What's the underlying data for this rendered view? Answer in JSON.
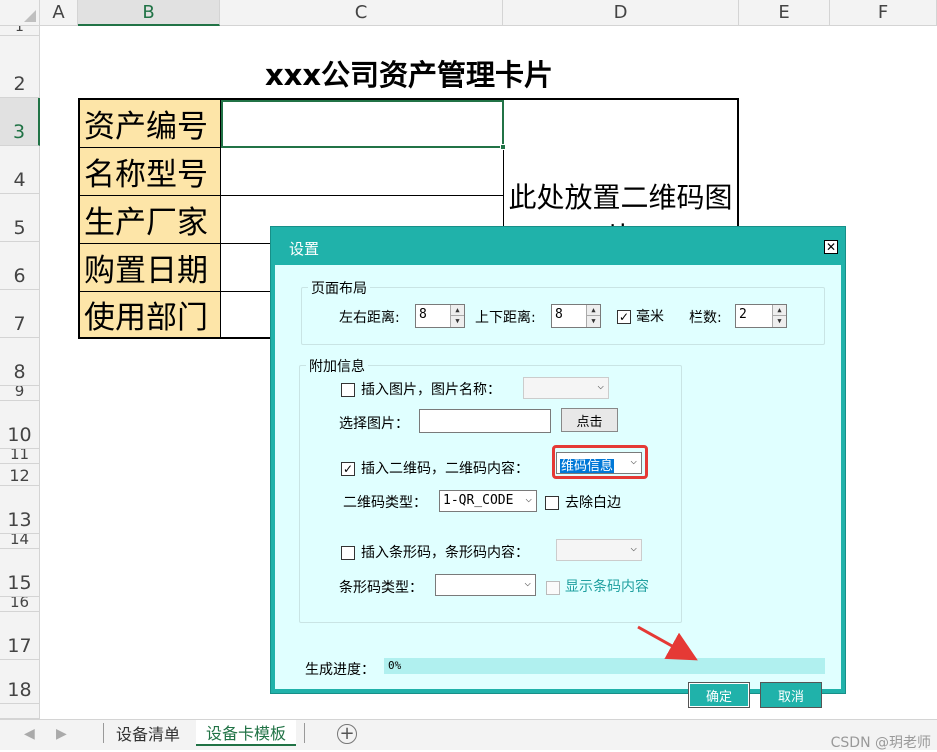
{
  "columns": [
    "A",
    "B",
    "C",
    "D",
    "E",
    "F"
  ],
  "rows": [
    "1",
    "2",
    "3",
    "4",
    "5",
    "6",
    "7",
    "8",
    "9",
    "10",
    "11",
    "12",
    "13",
    "14",
    "15",
    "16",
    "17",
    "18"
  ],
  "card": {
    "title": "xxx公司资产管理卡片",
    "labels": [
      "资产编号",
      "名称型号",
      "生产厂家",
      "购置日期",
      "使用部门"
    ],
    "qr_placeholder": "此处放置二维码图片"
  },
  "sheets": {
    "tabs": [
      "设备清单",
      "设备卡模板"
    ],
    "active": "设备卡模板",
    "add_icon": "plus-circle-icon"
  },
  "watermark": "CSDN @玥老师",
  "dialog": {
    "title": "设置",
    "close_icon": "close-icon",
    "page_layout": {
      "title": "页面布局",
      "lr_label": "左右距离:",
      "lr_value": "8",
      "tb_label": "上下距离:",
      "tb_value": "8",
      "mm_label": "毫米",
      "mm_checked": true,
      "cols_label": "栏数:",
      "cols_value": "2"
    },
    "extra": {
      "title": "附加信息",
      "insert_image_label": "插入图片，图片名称：",
      "choose_image_label": "选择图片：",
      "click_button": "点击",
      "insert_qr_label": "插入二维码，二维码内容：",
      "qr_content": "维码信息",
      "qr_type_label": "二维码类型：",
      "qr_type_value": "1-QR_CODE",
      "remove_border_label": "去除白边",
      "insert_barcode_label": "插入条形码，条形码内容：",
      "barcode_type_label": "条形码类型：",
      "show_barcode_label": "显示条码内容"
    },
    "progress_label": "生成进度：",
    "progress_text": "0%",
    "progress_value": 0,
    "ok_button": "确定",
    "cancel_button": "取消"
  },
  "colors": {
    "dialog_border": "#20b2aa",
    "dialog_body": "#e0ffff",
    "label_fill": "#fde5a8",
    "highlight": "#e53935",
    "excel_green": "#217346"
  }
}
